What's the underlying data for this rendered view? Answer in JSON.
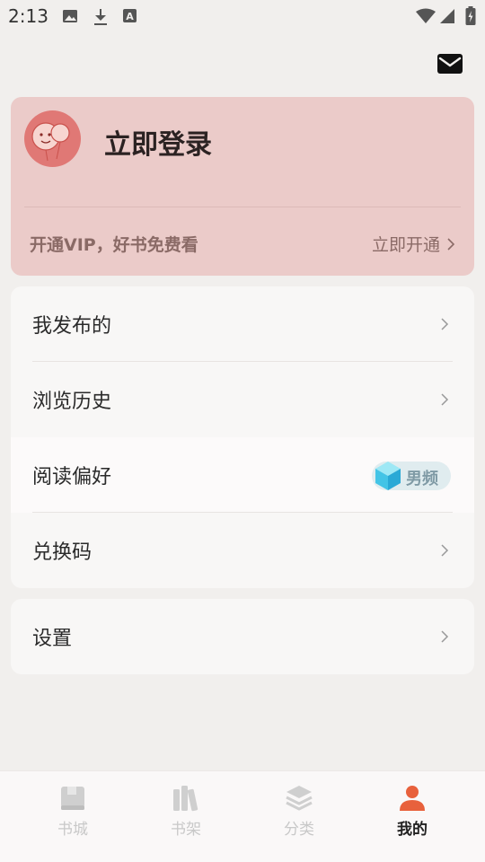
{
  "status_bar": {
    "time": "2:13",
    "left_icons": [
      "image-icon",
      "download-icon",
      "text-a-icon"
    ],
    "right_icons": [
      "wifi-icon",
      "signal-icon",
      "battery-icon"
    ]
  },
  "header": {
    "mail_icon": "mail-icon"
  },
  "login_card": {
    "title": "立即登录",
    "vip_text": "开通VIP，好书免费看",
    "vip_action": "立即开通",
    "background": "#ebcbc9"
  },
  "menu": {
    "items": [
      {
        "label": "我发布的"
      },
      {
        "label": "浏览历史"
      },
      {
        "label": "阅读偏好",
        "badge": "男频"
      },
      {
        "label": "兑换码"
      }
    ]
  },
  "settings": {
    "label": "设置"
  },
  "bottom_nav": {
    "items": [
      {
        "label": "书城",
        "icon": "book-icon"
      },
      {
        "label": "书架",
        "icon": "bookshelf-icon"
      },
      {
        "label": "分类",
        "icon": "layers-icon"
      },
      {
        "label": "我的",
        "icon": "user-icon",
        "active": true
      }
    ],
    "active_color": "#e8613c",
    "inactive_color": "#c8c8c8"
  }
}
